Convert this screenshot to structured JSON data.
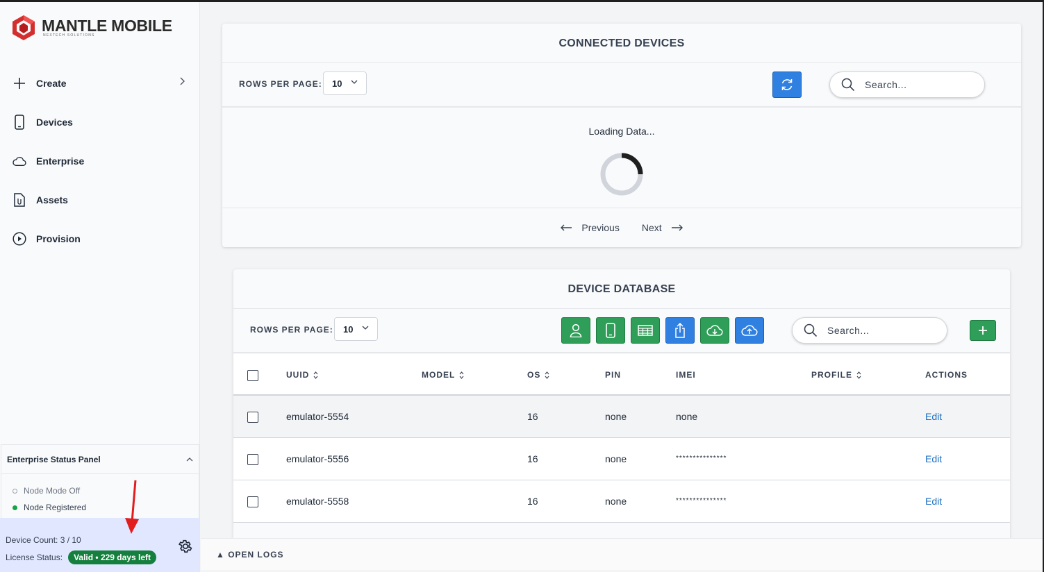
{
  "brand": {
    "name": "MANTLE MOBILE",
    "tagline": "NEXTECH SOLUTIONS"
  },
  "sidebar": {
    "items": [
      {
        "label": "Create",
        "icon": "plus-icon",
        "has_chevron": true
      },
      {
        "label": "Devices",
        "icon": "phone-icon"
      },
      {
        "label": "Enterprise",
        "icon": "cloud-icon"
      },
      {
        "label": "Assets",
        "icon": "file-icon"
      },
      {
        "label": "Provision",
        "icon": "play-circle-icon"
      }
    ]
  },
  "status_panel": {
    "title": "Enterprise Status Panel",
    "node_mode": "Node Mode Off",
    "node_registered": "Node Registered",
    "device_count": "Device Count: 3 / 10",
    "license_label": "License Status:",
    "license_badge": "Valid • 229 days left"
  },
  "connected": {
    "title": "CONNECTED DEVICES",
    "rows_label": "ROWS PER PAGE:",
    "rows_value": "10",
    "search_placeholder": "Search...",
    "loading": "Loading Data...",
    "prev": "Previous",
    "next": "Next"
  },
  "database": {
    "title": "DEVICE DATABASE",
    "rows_label": "ROWS PER PAGE:",
    "rows_value": "10",
    "search_placeholder": "Search...",
    "columns": {
      "uuid": "UUID",
      "model": "MODEL",
      "os": "OS",
      "pin": "PIN",
      "imei": "IMEI",
      "profile": "PROFILE",
      "actions": "ACTIONS"
    },
    "rows": [
      {
        "uuid": "emulator-5554",
        "model": "",
        "os": "16",
        "pin": "none",
        "imei": "none",
        "profile": "",
        "action": "Edit"
      },
      {
        "uuid": "emulator-5556",
        "model": "",
        "os": "16",
        "pin": "none",
        "imei": "***************",
        "profile": "",
        "action": "Edit"
      },
      {
        "uuid": "emulator-5558",
        "model": "",
        "os": "16",
        "pin": "none",
        "imei": "***************",
        "profile": "",
        "action": "Edit"
      }
    ]
  },
  "logs": {
    "label": "▲ OPEN LOGS"
  },
  "colors": {
    "accent_blue": "#2f80e0",
    "accent_green": "#2e9e58",
    "badge_green": "#15803d",
    "brand_red": "#d32f2f",
    "link": "#1d6fc2"
  }
}
